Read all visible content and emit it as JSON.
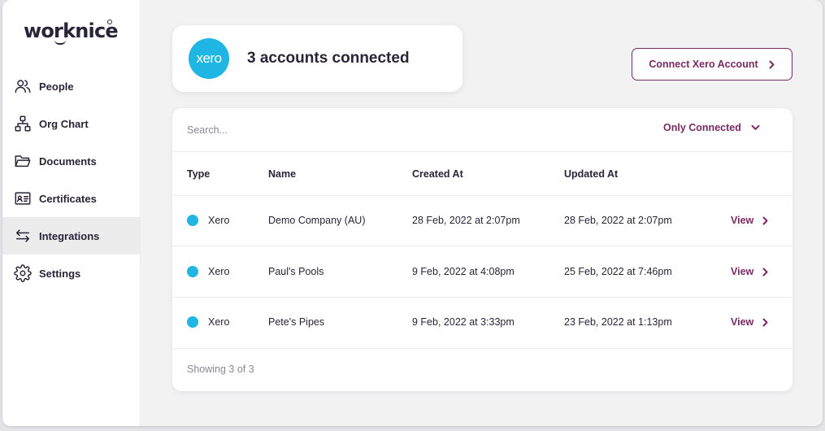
{
  "brand": {
    "name": "worknice"
  },
  "sidebar": {
    "items": [
      {
        "label": "People",
        "icon": "people-icon"
      },
      {
        "label": "Org Chart",
        "icon": "org-chart-icon"
      },
      {
        "label": "Documents",
        "icon": "folder-icon"
      },
      {
        "label": "Certificates",
        "icon": "certificate-icon"
      },
      {
        "label": "Integrations",
        "icon": "arrows-swap-icon",
        "active": true
      },
      {
        "label": "Settings",
        "icon": "gear-icon"
      }
    ]
  },
  "summary": {
    "logo_text": "xero",
    "text": "3 accounts connected"
  },
  "connect_button": {
    "label": "Connect Xero Account"
  },
  "search": {
    "placeholder": "Search..."
  },
  "filter": {
    "selected": "Only Connected"
  },
  "table": {
    "columns": [
      "Type",
      "Name",
      "Created At",
      "Updated At"
    ],
    "rows": [
      {
        "type": "Xero",
        "name": "Demo Company (AU)",
        "created": "28 Feb, 2022 at 2:07pm",
        "updated": "28 Feb, 2022 at 2:07pm",
        "action": "View"
      },
      {
        "type": "Xero",
        "name": "Paul's Pools",
        "created": "9 Feb, 2022 at 4:08pm",
        "updated": "25 Feb, 2022 at 7:46pm",
        "action": "View"
      },
      {
        "type": "Xero",
        "name": "Pete's Pipes",
        "created": "9 Feb, 2022 at 3:33pm",
        "updated": "23 Feb, 2022 at 1:13pm",
        "action": "View"
      }
    ],
    "footer": "Showing 3 of 3"
  },
  "colors": {
    "accent": "#7a2a63",
    "xero_blue": "#1fb6e3",
    "text": "#2a2438",
    "muted": "#8b8794",
    "background": "#f2f2f3"
  }
}
